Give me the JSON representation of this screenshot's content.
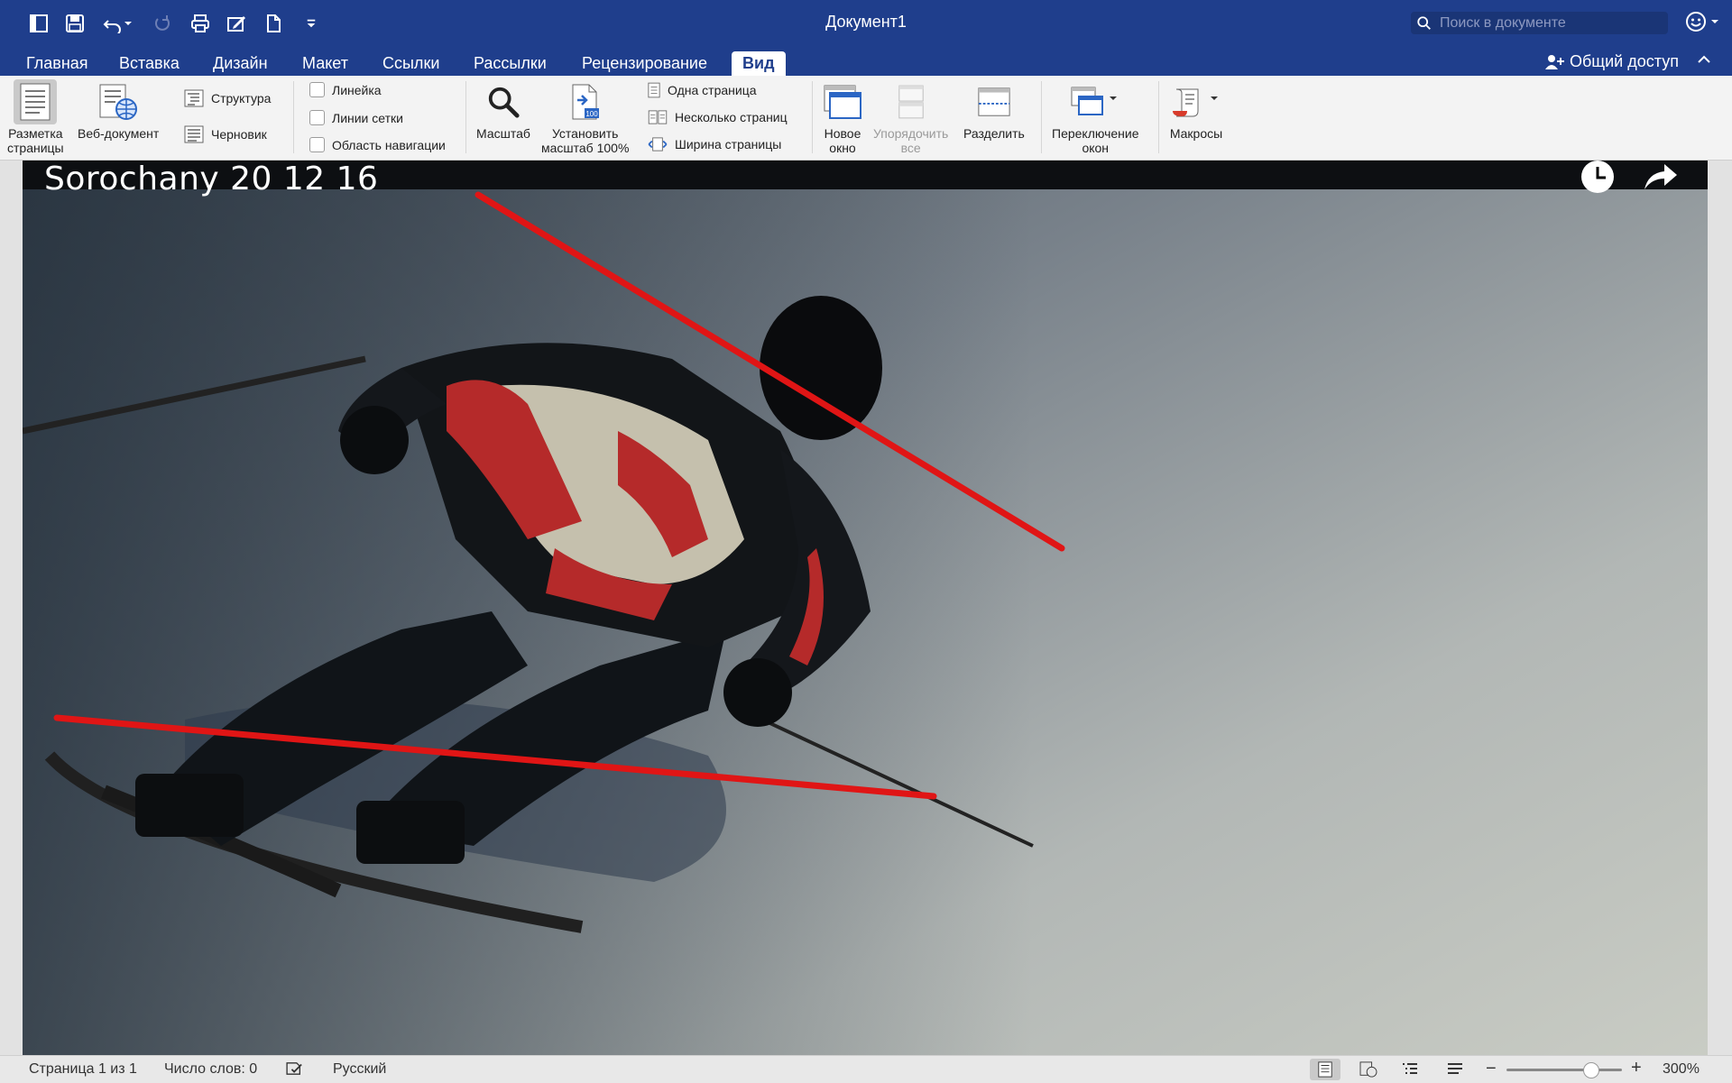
{
  "window": {
    "title": "Документ1",
    "search_placeholder": "Поиск в документе",
    "share_label": "Общий доступ",
    "accent": "#1f3e8c"
  },
  "quick_access": [
    {
      "name": "sidebar-icon"
    },
    {
      "name": "save-icon"
    },
    {
      "name": "undo-icon"
    },
    {
      "name": "redo-icon"
    },
    {
      "name": "print-icon"
    },
    {
      "name": "edit-icon"
    },
    {
      "name": "new-document-icon"
    },
    {
      "name": "customize-icon"
    }
  ],
  "tabs": [
    {
      "label": "Главная"
    },
    {
      "label": "Вставка"
    },
    {
      "label": "Дизайн"
    },
    {
      "label": "Макет"
    },
    {
      "label": "Ссылки"
    },
    {
      "label": "Рассылки"
    },
    {
      "label": "Рецензирование"
    },
    {
      "label": "Вид",
      "active": true
    }
  ],
  "ribbon": {
    "views": {
      "print_layout": "Разметка\nстраницы",
      "web_layout": "Веб-документ",
      "outline": "Структура",
      "draft": "Черновик"
    },
    "show": {
      "ruler": "Линейка",
      "gridlines": "Линии сетки",
      "nav_pane": "Область навигации"
    },
    "zoom": {
      "zoom": "Масштаб",
      "zoom100": "Установить\nмасштаб 100%",
      "one_page": "Одна страница",
      "multiple_pages": "Несколько страниц",
      "page_width": "Ширина страницы"
    },
    "window": {
      "new_window": "Новое\nокно",
      "arrange_all": "Упорядочить\nвсе",
      "split": "Разделить",
      "switch_windows": "Переключение\nокон"
    },
    "macros": "Макросы"
  },
  "document": {
    "video_title": "Sorochany 20 12 16"
  },
  "status": {
    "page": "Страница 1 из 1",
    "words": "Число слов: 0",
    "language": "Русский",
    "zoom": "300%"
  }
}
